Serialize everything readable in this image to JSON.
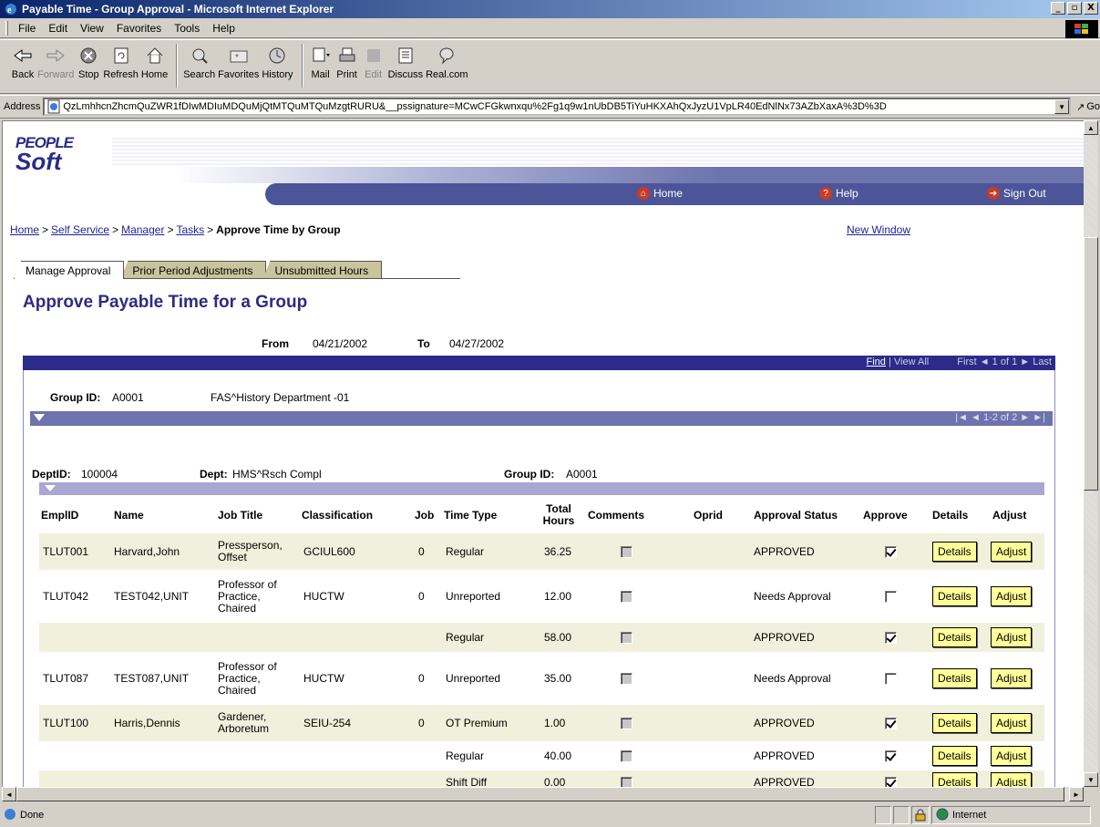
{
  "window": {
    "title": "Payable Time - Group Approval - Microsoft Internet Explorer",
    "min": "_",
    "max": "▫",
    "close": "X"
  },
  "menu": [
    "File",
    "Edit",
    "View",
    "Favorites",
    "Tools",
    "Help"
  ],
  "toolbar": {
    "back": "Back",
    "forward": "Forward",
    "stop": "Stop",
    "refresh": "Refresh",
    "home": "Home",
    "search": "Search",
    "favorites": "Favorites",
    "history": "History",
    "mail": "Mail",
    "print": "Print",
    "edit": "Edit",
    "discuss": "Discuss",
    "realcom": "Real.com"
  },
  "address": {
    "label": "Address",
    "value": "QzLmhhcnZhcmQuZWR1fDIwMDIuMDQuMjQtMTQuMTQuMzgtRURU&__pssignature=MCwCFGkwnxqu%2Fg1q9w1nUbDB5TiYuHKXAhQxJyzU1VpLR40EdNlNx73AZbXaxA%3D%3D",
    "go": "Go"
  },
  "status": {
    "text": "Done",
    "zone": "Internet"
  },
  "ps": {
    "logo_top": "PEOPLE",
    "logo_bottom": "Soft",
    "nav": {
      "home": "Home",
      "help": "Help",
      "signout": "Sign Out"
    },
    "breadcrumb": {
      "home": "Home",
      "self_service": "Self Service",
      "manager": "Manager",
      "tasks": "Tasks",
      "current": "Approve Time by Group",
      "sep": ">"
    },
    "new_window": "New Window",
    "tabs": [
      "Manage Approval",
      "Prior Period Adjustments",
      "Unsubmitted Hours"
    ],
    "title": "Approve Payable Time for a Group",
    "from_label": "From",
    "from": "04/21/2002",
    "to_label": "To",
    "to": "04/27/2002",
    "band": {
      "find": "Find",
      "view_all": "View All",
      "nav": "First ◄ 1 of 1 ► Last"
    },
    "group": {
      "label": "Group ID:",
      "id": "A0001",
      "desc": "FAS^History Department -01"
    },
    "inner_pager": "|◄ ◄ 1-2 of 2 ► ►|",
    "dept": {
      "deptid_label": "DeptID:",
      "deptid": "100004",
      "dept_label": "Dept:",
      "dept": "HMS^Rsch Compl",
      "group_label": "Group ID:",
      "group": "A0001"
    },
    "columns": {
      "emplid": "EmplID",
      "name": "Name",
      "job_title": "Job Title",
      "classification": "Classification",
      "job": "Job",
      "time_type": "Time Type",
      "total_hours": "Total Hours",
      "comments": "Comments",
      "oprid": "Oprid",
      "approval_status": "Approval Status",
      "approve": "Approve",
      "details": "Details",
      "adjust": "Adjust"
    },
    "rows": [
      {
        "emplid": "TLUT001",
        "name": "Harvard,John",
        "job_title": "Pressperson, Offset",
        "classification": "GCIUL600",
        "job": "0",
        "time_type": "Regular",
        "hours": "36.25",
        "status": "APPROVED",
        "approved": true
      },
      {
        "emplid": "TLUT042",
        "name": "TEST042,UNIT",
        "job_title": "Professor of Practice, Chaired",
        "classification": "HUCTW",
        "job": "0",
        "time_type": "Unreported",
        "hours": "12.00",
        "status": "Needs Approval",
        "approved": false
      },
      {
        "emplid": "",
        "name": "",
        "job_title": "",
        "classification": "",
        "job": "",
        "time_type": "Regular",
        "hours": "58.00",
        "status": "APPROVED",
        "approved": true
      },
      {
        "emplid": "TLUT087",
        "name": "TEST087,UNIT",
        "job_title": "Professor of Practice, Chaired",
        "classification": "HUCTW",
        "job": "0",
        "time_type": "Unreported",
        "hours": "35.00",
        "status": "Needs Approval",
        "approved": false
      },
      {
        "emplid": "TLUT100",
        "name": "Harris,Dennis",
        "job_title": "Gardener, Arboretum",
        "classification": "SEIU-254",
        "job": "0",
        "time_type": "OT Premium",
        "hours": "1.00",
        "status": "APPROVED",
        "approved": true
      },
      {
        "emplid": "",
        "name": "",
        "job_title": "",
        "classification": "",
        "job": "",
        "time_type": "Regular",
        "hours": "40.00",
        "status": "APPROVED",
        "approved": true
      },
      {
        "emplid": "",
        "name": "",
        "job_title": "",
        "classification": "",
        "job": "",
        "time_type": "Shift Diff",
        "hours": "0.00",
        "status": "APPROVED",
        "approved": true
      }
    ],
    "details_label": "Details",
    "adjust_label": "Adjust"
  }
}
